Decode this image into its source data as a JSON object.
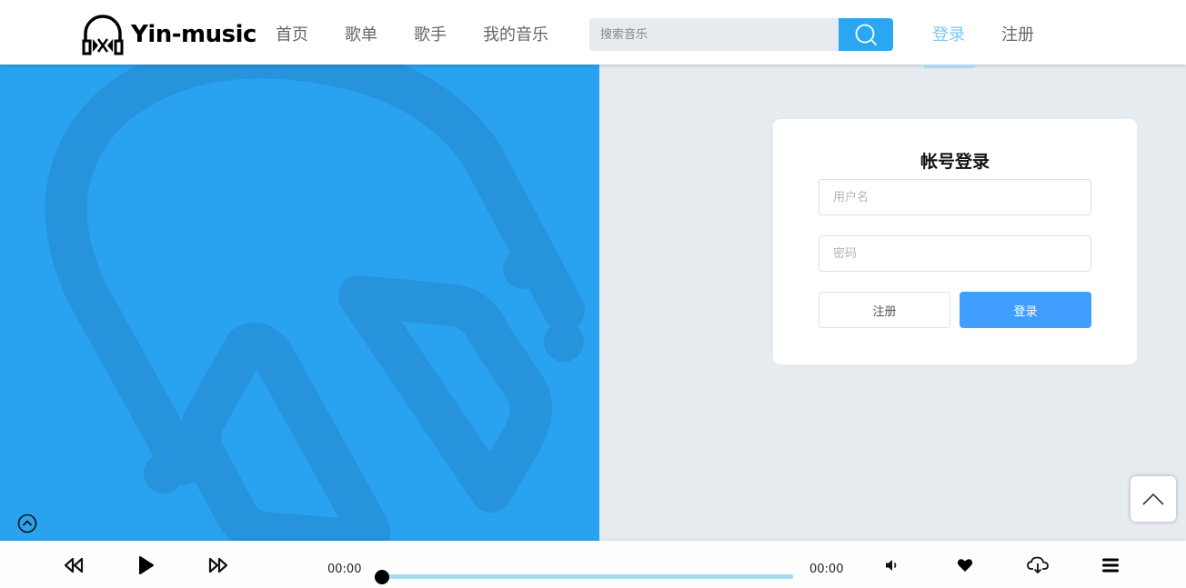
{
  "header": {
    "brand": "Yin-music",
    "nav": [
      {
        "label": "首页"
      },
      {
        "label": "歌单"
      },
      {
        "label": "歌手"
      },
      {
        "label": "我的音乐"
      }
    ],
    "search": {
      "placeholder": "搜索音乐",
      "icon": "search-icon"
    },
    "login_label": "登录",
    "register_label": "注册"
  },
  "login_card": {
    "title": "帐号登录",
    "username_placeholder": "用户名",
    "password_placeholder": "密码",
    "register_button": "注册",
    "login_button": "登录"
  },
  "player": {
    "current_time": "00:00",
    "total_time": "00:00",
    "progress": 0,
    "icons": [
      "rewind-icon",
      "play-icon",
      "fast-forward-icon",
      "volume-icon",
      "heart-icon",
      "cloud-download-icon",
      "menu-icon"
    ]
  },
  "colors": {
    "accent": "#2aa7f0",
    "hero_bg": "#29a2ef",
    "hero_shape": "#2693dc",
    "login_button": "#409eff",
    "progress_track": "#a7dbf3",
    "active_nav": "#7ec7ed",
    "page_bg": "#e6ebef"
  }
}
